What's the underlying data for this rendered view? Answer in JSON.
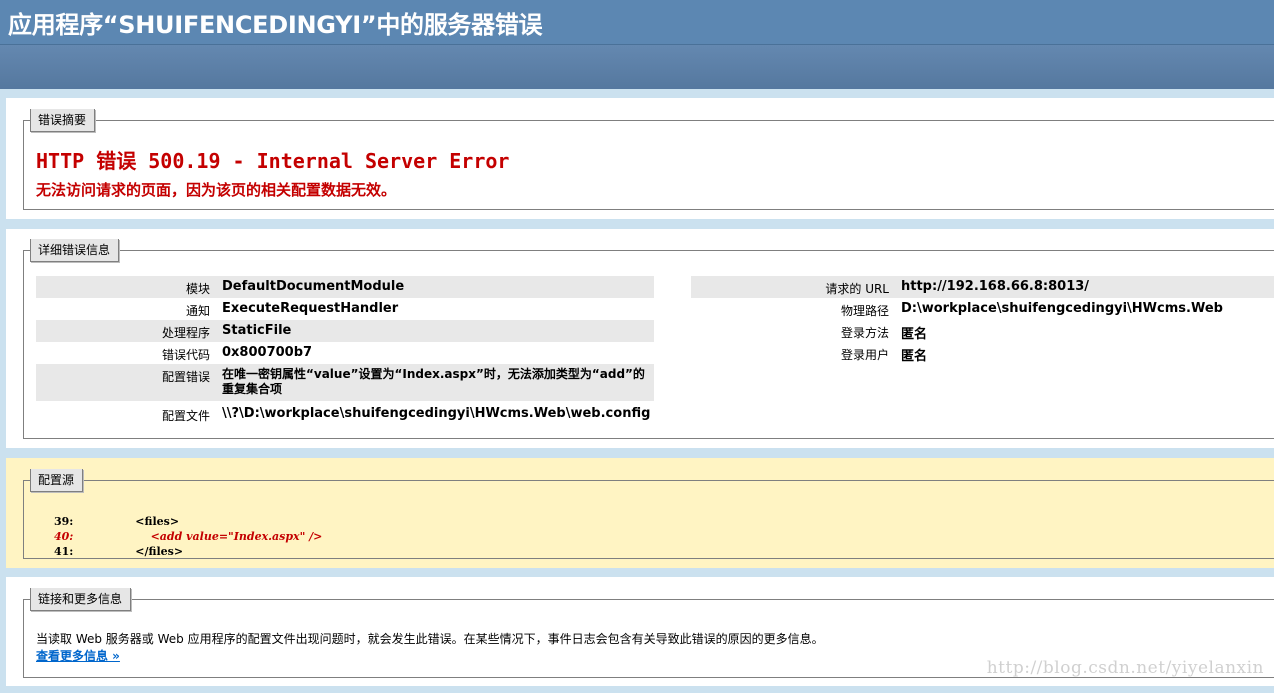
{
  "header": {
    "title": "应用程序“SHUIFENCEDINGYI”中的服务器错误"
  },
  "summary": {
    "legend": "错误摘要",
    "error_title": "HTTP 错误 500.19 - Internal Server Error",
    "error_desc": "无法访问请求的页面，因为该页的相关配置数据无效。"
  },
  "details": {
    "legend": "详细错误信息",
    "left_rows": [
      {
        "label": "模块",
        "value": "DefaultDocumentModule"
      },
      {
        "label": "通知",
        "value": "ExecuteRequestHandler"
      },
      {
        "label": "处理程序",
        "value": "StaticFile"
      },
      {
        "label": "错误代码",
        "value": "0x800700b7"
      },
      {
        "label": "配置错误",
        "value": "在唯一密钥属性“value”设置为“Index.aspx”时，无法添加类型为“add”的重复集合项"
      },
      {
        "label": "配置文件",
        "value": "\\\\?\\D:\\workplace\\shuifengcedingyi\\HWcms.Web\\web.config"
      }
    ],
    "right_rows": [
      {
        "label": "请求的 URL",
        "value": "http://192.168.66.8:8013/"
      },
      {
        "label": "物理路径",
        "value": "D:\\workplace\\shuifengcedingyi\\HWcms.Web"
      },
      {
        "label": "登录方法",
        "value": "匿名"
      },
      {
        "label": "登录用户",
        "value": "匿名"
      }
    ]
  },
  "config_source": {
    "legend": "配置源",
    "lines": [
      {
        "num": "39:",
        "code": "                <files>"
      },
      {
        "num": "40:",
        "code": "                    <add value=\"Index.aspx\" />"
      },
      {
        "num": "41:",
        "code": "                </files>"
      }
    ]
  },
  "more_info": {
    "legend": "链接和更多信息",
    "text": "当读取 Web 服务器或 Web 应用程序的配置文件出现问题时，就会发生此错误。在某些情况下，事件日志会包含有关导致此错误的原因的更多信息。",
    "link": "查看更多信息 »"
  },
  "watermark": "http://blog.csdn.net/yiyelanxin",
  "colors": {
    "header_bg": "#5c87b2",
    "page_bg": "#cbe1ef",
    "error_red": "#c40000",
    "config_bg": "#fff4c3",
    "link_blue": "#0066cc"
  }
}
